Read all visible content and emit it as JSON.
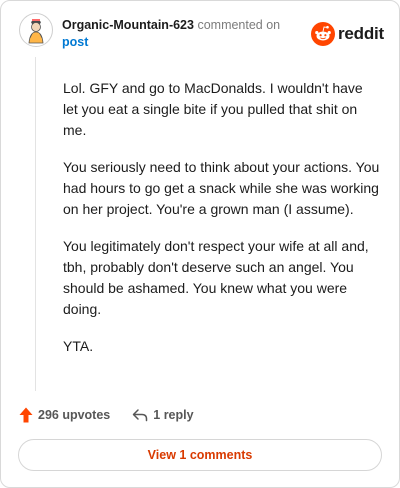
{
  "header": {
    "author": "Organic-Mountain-623",
    "action": "commented on",
    "post_link": "post",
    "brand": "reddit"
  },
  "comment": {
    "paragraphs": [
      "Lol. GFY and go to MacDonalds. I wouldn't have let you eat a single bite if you pulled that shit on me.",
      "You seriously need to think about your actions. You had hours to go get a snack while she was working on her project. You're a grown man (I assume).",
      "You legitimately don't respect your wife at all and, tbh, probably don't deserve such an angel. You should be ashamed. You knew what you were doing.",
      "YTA."
    ]
  },
  "actions": {
    "upvotes": "296 upvotes",
    "replies": "1 reply"
  },
  "footer": {
    "view_comments": "View 1 comments"
  },
  "colors": {
    "brand_orange": "#ff4500",
    "link_blue": "#0079d3",
    "view_button_text": "#d93a00"
  },
  "icons": {
    "avatar": "avatar-icon",
    "brand": "reddit-snoo-icon",
    "upvote": "upvote-arrow-icon",
    "reply": "reply-arrow-icon"
  }
}
